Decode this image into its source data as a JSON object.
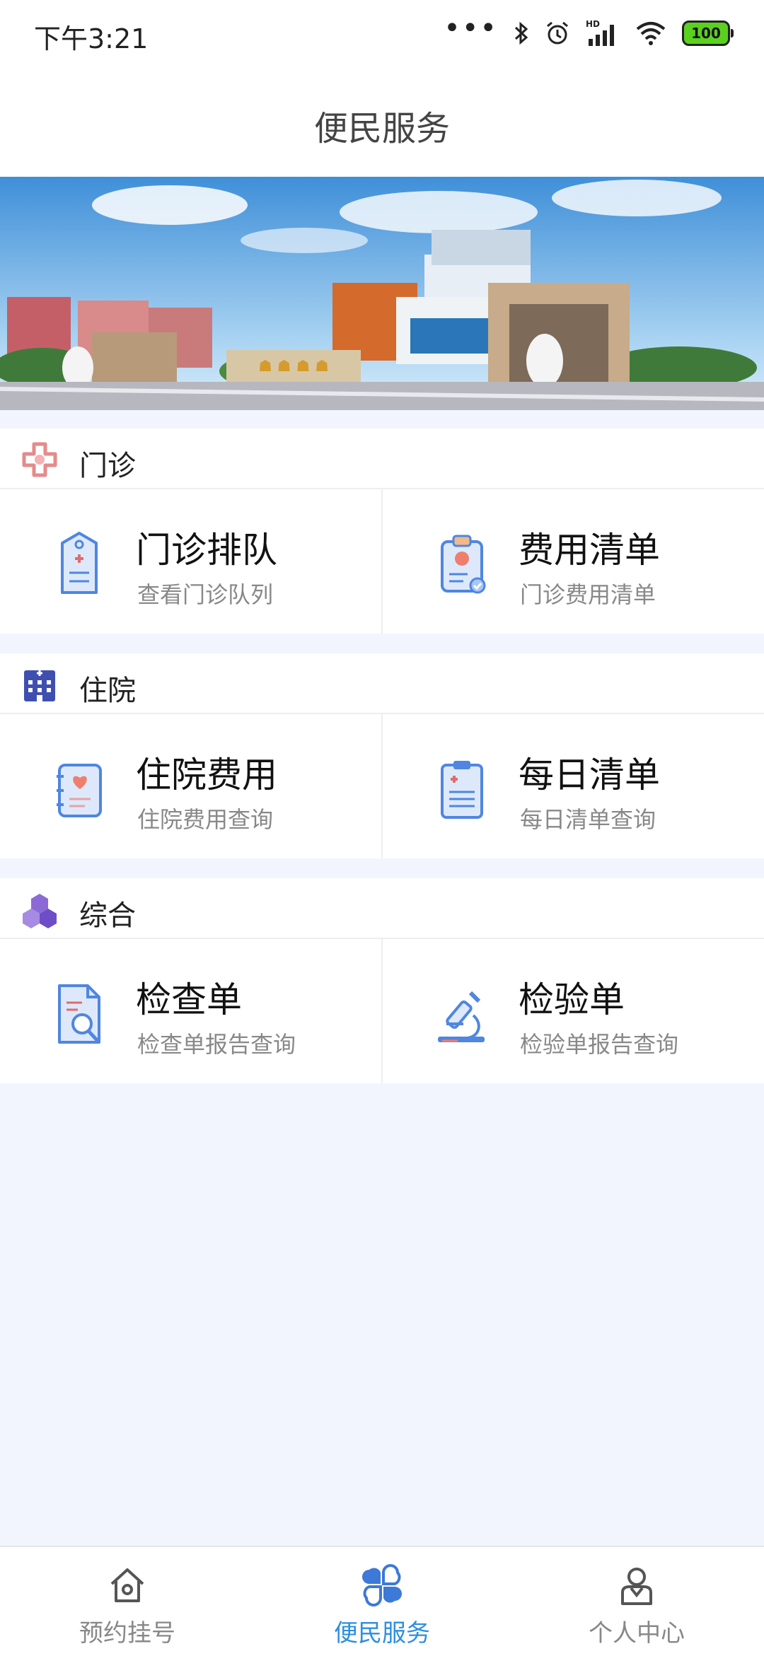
{
  "status": {
    "time": "下午3:21",
    "battery": "100",
    "signal_badge": "HD"
  },
  "header": {
    "title": "便民服务"
  },
  "sections": [
    {
      "label": "门诊",
      "icon": "outpatient-cross-icon",
      "cards": [
        {
          "title": "门诊排队",
          "subtitle": "查看门诊队列",
          "icon": "queue-tag-icon"
        },
        {
          "title": "费用清单",
          "subtitle": "门诊费用清单",
          "icon": "fee-list-icon"
        }
      ]
    },
    {
      "label": "住院",
      "icon": "hospital-building-icon",
      "cards": [
        {
          "title": "住院费用",
          "subtitle": "住院费用查询",
          "icon": "heart-record-icon"
        },
        {
          "title": "每日清单",
          "subtitle": "每日清单查询",
          "icon": "clipboard-icon"
        }
      ]
    },
    {
      "label": "综合",
      "icon": "cubes-icon",
      "cards": [
        {
          "title": "检查单",
          "subtitle": "检查单报告查询",
          "icon": "report-search-icon"
        },
        {
          "title": "检验单",
          "subtitle": "检验单报告查询",
          "icon": "microscope-icon"
        }
      ]
    }
  ],
  "tabbar": {
    "items": [
      {
        "label": "预约挂号",
        "icon": "home-icon",
        "active": false
      },
      {
        "label": "便民服务",
        "icon": "clover-icon",
        "active": true
      },
      {
        "label": "个人中心",
        "icon": "person-icon",
        "active": false
      }
    ]
  },
  "colors": {
    "accent": "#2d8ee0",
    "background": "#f2f5fd",
    "icon_blue": "#5b8fe6"
  }
}
